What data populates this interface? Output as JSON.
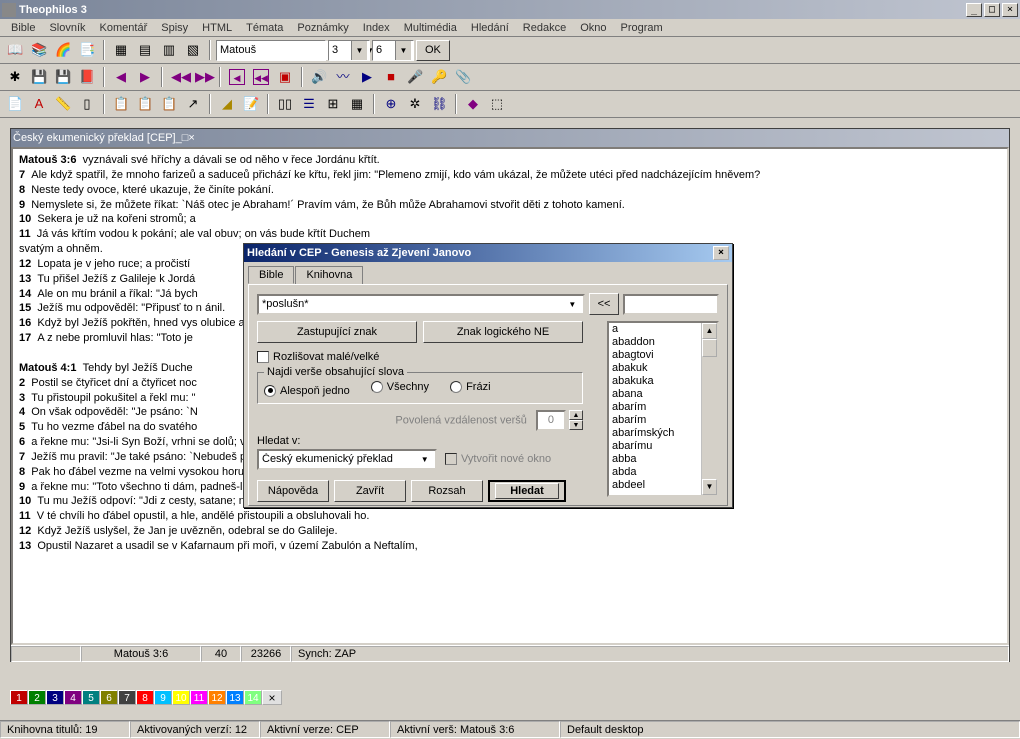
{
  "app": {
    "title": "Theophilos 3"
  },
  "menus": [
    "Bible",
    "Slovník",
    "Komentář",
    "Spisy",
    "HTML",
    "Témata",
    "Poznámky",
    "Index",
    "Multimédia",
    "Hledání",
    "Redakce",
    "Okno",
    "Program"
  ],
  "nav": {
    "book": "Matouš",
    "chapter": "3",
    "verse": "6",
    "ok": "OK"
  },
  "doc": {
    "title": "Český ekumenický překlad [CEP]",
    "lines": [
      {
        "ref": "Matouš 3:6",
        "text": "vyznávali své hříchy a dávali se od něho v řece Jordánu křtít."
      },
      {
        "num": "7",
        "text": "Ale když spatřil, že mnoho farizeů a saduceů přichází ke křtu, řekl jim: \"Plemeno zmijí, kdo vám ukázal, že můžete utéci před nadcházejícím hněvem?"
      },
      {
        "num": "8",
        "text": "Neste tedy ovoce, které ukazuje, že činíte pokání."
      },
      {
        "num": "9",
        "text": "Nemyslete si, že můžete říkat: `Náš otec je Abraham!´ Pravím vám, že Bůh může Abrahamovi stvořit děti z tohoto kamení."
      },
      {
        "num": "10",
        "text": "Sekera je už na kořeni stromů; a"
      },
      {
        "num": "11",
        "text": "Já vás křtím vodou k pokání; ale                                                                                                                                                       val obuv; on vás bude křtít Duchem"
      },
      {
        "cont": "svatým a ohněm."
      },
      {
        "num": "12",
        "text": "Lopata je v jeho ruce; a pročistí"
      },
      {
        "num": "13",
        "text": "Tu přišel Ježíš z Galileje k Jordá"
      },
      {
        "num": "14",
        "text": "Ale on mu bránil a říkal: \"Já bych"
      },
      {
        "num": "15",
        "text": "Ježíš mu odpověděl: \"Připusť to n                                                                                                                                                     ánil."
      },
      {
        "num": "16",
        "text": "Když byl Ježíš pokřtěn, hned vys                                                                                                                                                       olubice a přichází na něho."
      },
      {
        "num": "17",
        "text": "A z nebe promluvil hlas: \"Toto je"
      },
      {
        "blank": true
      },
      {
        "ref": "Matouš 4:1",
        "text": "Tehdy byl Ježíš Duche"
      },
      {
        "num": "2",
        "text": "Postil se čtyřicet dní a čtyřicet noc"
      },
      {
        "num": "3",
        "text": "Tu přistoupil pokušitel a řekl mu: \""
      },
      {
        "num": "4",
        "text": "On však odpověděl: \"Je psáno: `N"
      },
      {
        "num": "5",
        "text": "Tu ho vezme ďábel na do svatého"
      },
      {
        "num": "6",
        "text": "a řekne mu: \"Jsi-li Syn Boží, vrhni se dolů; vždyť je psáno: `Svým andělům dá příkaz a na ruce tě vezmou, abys nenarazil nohou na kámen´!\""
      },
      {
        "num": "7",
        "text": "Ježíš mu pravil: \"Je také psáno: `Nebudeš pokoušet Hospodina, Boha svého.´\""
      },
      {
        "num": "8",
        "text": "Pak ho ďábel vezme na velmi vysokou horu, ukáže mu všechna království světa i jejich slávu"
      },
      {
        "num": "9",
        "text": "a řekne mu: \"Toto všechno ti dám, padneš-li přede mnou a budeš se mi klanět.\""
      },
      {
        "num": "10",
        "text": "Tu mu Ježíš odpoví: \"Jdi z cesty, satane; neboť je psáno: `Hospodinu, Bohu svému, se budeš klanět a jeho jediného uctívat.´"
      },
      {
        "num": "11",
        "text": "V té chvíli ho ďábel opustil, a hle, andělé přistoupili a obsluhovali ho."
      },
      {
        "num": "12",
        "text": "Když Ježíš uslyšel, že Jan je uvězněn, odebral se do Galileje."
      },
      {
        "num": "13",
        "text": "Opustil Nazaret a usadil se v Kafarnaum při moři, v území Zabulón a Neftalím,"
      }
    ],
    "status": {
      "ref": "Matouš 3:6",
      "n1": "40",
      "n2": "23266",
      "sync": "Synch: ZAP"
    }
  },
  "search": {
    "title": "Hledání v CEP - Genesis až Zjevení Janovo",
    "tabs": {
      "bible": "Bible",
      "lib": "Knihovna"
    },
    "query": "*poslušn*",
    "btn_back": "<<",
    "btn_wildcard": "Zastupující znak",
    "btn_not": "Znak logického NE",
    "case_label": "Rozlišovat malé/velké",
    "group_label": "Najdi verše obsahující slova",
    "radio1": "Alespoň jedno",
    "radio2": "Všechny",
    "radio3": "Frázi",
    "dist_label": "Povolená vzdálenost veršů",
    "dist_value": "0",
    "scope_label": "Hledat v:",
    "scope_value": "Český ekumenický překlad",
    "newwin": "Vytvořit nové okno",
    "btn_help": "Nápověda",
    "btn_close": "Zavřít",
    "btn_range": "Rozsah",
    "btn_search": "Hledat",
    "words": [
      "a",
      "abaddon",
      "abagtovi",
      "abakuk",
      "abakuka",
      "abana",
      "abarím",
      "abarím",
      "abarímských",
      "abarímu",
      "abba",
      "abda",
      "abdeel"
    ]
  },
  "bottom_tabs": [
    "1",
    "2",
    "3",
    "4",
    "5",
    "6",
    "7",
    "8",
    "9",
    "10",
    "11",
    "12",
    "13",
    "14"
  ],
  "tab_colors": [
    "#c00000",
    "#008000",
    "#000080",
    "#800080",
    "#008080",
    "#808000",
    "#404040",
    "#ff0000",
    "#00c0ff",
    "#ffff00",
    "#ff00ff",
    "#ff8000",
    "#0080ff",
    "#80ff80"
  ],
  "status": {
    "s1": "Knihovna titulů: 19",
    "s2": "Aktivovaných verzí: 12",
    "s3": "Aktivní verze: CEP",
    "s4": "Aktivní verš: Matouš 3:6",
    "s5": "Default desktop"
  }
}
